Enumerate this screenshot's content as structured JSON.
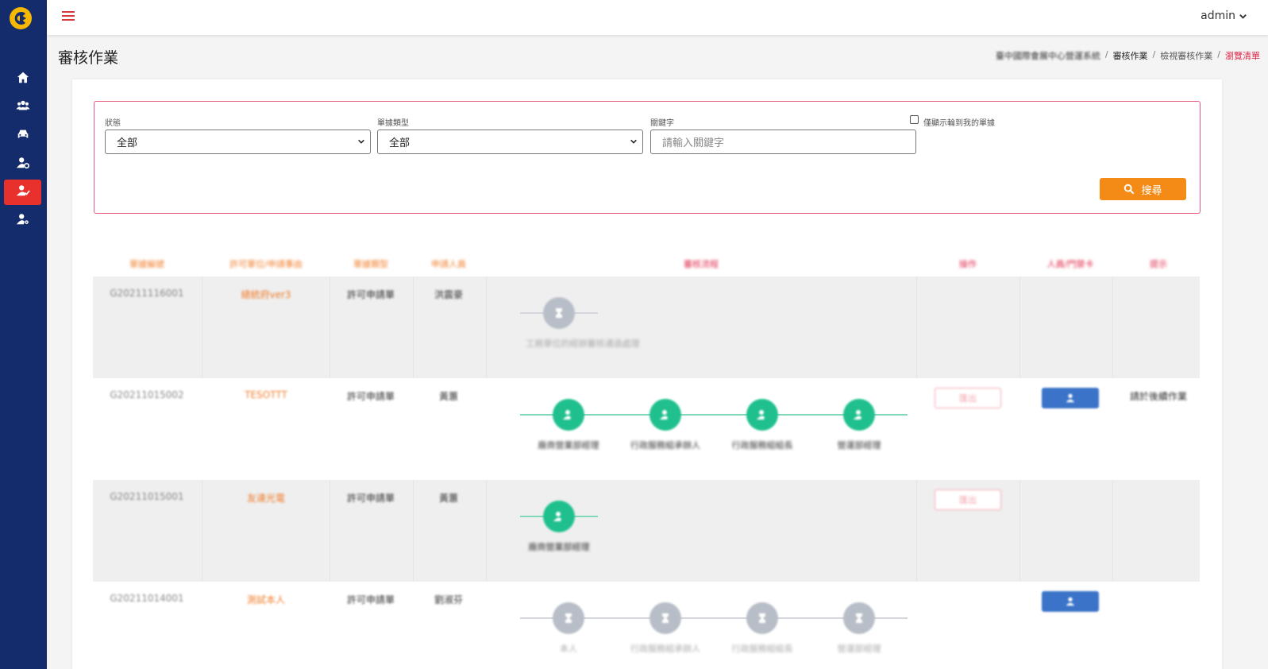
{
  "topbar": {
    "user_label": "admin"
  },
  "page": {
    "title": "審核作業"
  },
  "breadcrumb": [
    {
      "label": "臺中國際會展中心營運系統",
      "state": "muted"
    },
    {
      "label": "審核作業",
      "state": "normal"
    },
    {
      "label": "檢視審核作業",
      "state": "normal"
    },
    {
      "label": "瀏覽清單",
      "state": "current"
    }
  ],
  "sidebar": {
    "items": [
      {
        "icon": "home-icon"
      },
      {
        "icon": "users-icon"
      },
      {
        "icon": "car-icon"
      },
      {
        "icon": "user-cog-icon"
      },
      {
        "icon": "user-check-icon",
        "active": true
      },
      {
        "icon": "user-settings-icon"
      }
    ],
    "active_color": "#e8312d",
    "bg_color": "#142c6b"
  },
  "filters": {
    "status_label": "狀態",
    "status_value": "全部",
    "type_label": "單據類型",
    "type_value": "全部",
    "keyword_label": "關鍵字",
    "keyword_placeholder": "請輸入關鍵字",
    "only_mine_label": "僅顯示輪到我的單據",
    "search_label": "搜尋"
  },
  "table": {
    "headers": [
      "單據編號",
      "許可單位/申請事由",
      "單據類型",
      "申請人員",
      "審核流程",
      "操作",
      "人員/門禁卡",
      "提示"
    ],
    "rows": [
      {
        "id": "G20211116001",
        "name": "總統府ver3",
        "type": "許可申請單",
        "applicant": "洪震豪",
        "steps": [
          {
            "label": "工務單位的經辦審核通過處理",
            "status": "wait"
          }
        ],
        "has_out": false,
        "has_card": false,
        "tip": ""
      },
      {
        "id": "G20211015002",
        "name": "TESOTTT",
        "type": "許可申請單",
        "applicant": "黃蕙",
        "steps": [
          {
            "label": "廠商營業部經理",
            "status": "done"
          },
          {
            "label": "行政服務組承辦人",
            "status": "done"
          },
          {
            "label": "行政服務組組長",
            "status": "done"
          },
          {
            "label": "營運部經理",
            "status": "done"
          }
        ],
        "has_out": true,
        "has_card": true,
        "tip": "請於後續作業"
      },
      {
        "id": "G20211015001",
        "name": "友達光電",
        "type": "許可申請單",
        "applicant": "黃蕙",
        "steps": [
          {
            "label": "廠商營業部經理",
            "status": "done"
          }
        ],
        "has_out": true,
        "has_card": false,
        "tip": ""
      },
      {
        "id": "G20211014001",
        "name": "測試本人",
        "type": "許可申請單",
        "applicant": "劉淑芬",
        "steps": [
          {
            "label": "本人",
            "status": "wait"
          },
          {
            "label": "行政服務組承辦人",
            "status": "wait"
          },
          {
            "label": "行政服務組組長",
            "status": "wait"
          },
          {
            "label": "營運部經理",
            "status": "wait"
          }
        ],
        "has_out": false,
        "has_card": true,
        "tip": ""
      }
    ],
    "out_label": "匯出"
  },
  "colors": {
    "accent": "#f48b17",
    "filter_border": "#e75a7a",
    "step_done": "#20c08e",
    "step_wait": "#b8bec8",
    "card_button": "#3b73c8"
  }
}
